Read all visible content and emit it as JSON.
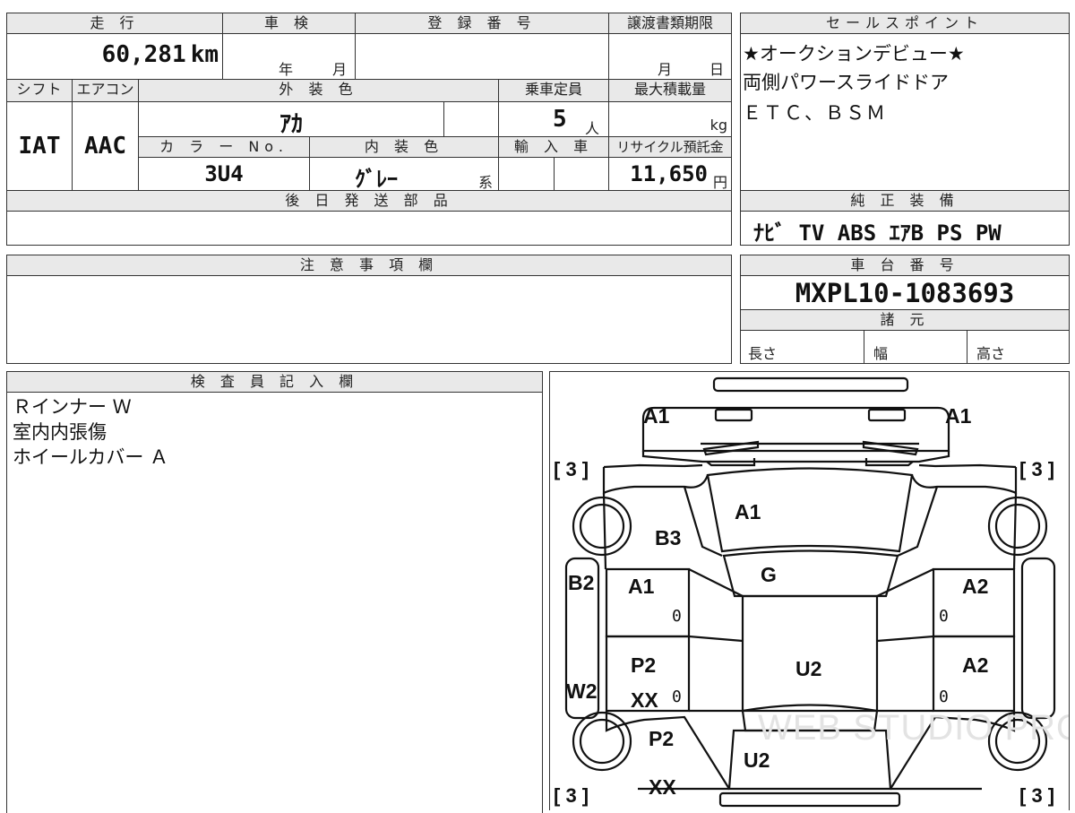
{
  "vehicle": {
    "mileage_label": "走 行",
    "mileage_value": "60,281",
    "mileage_unit": "km",
    "inspection_label": "車 検",
    "year_label": "年",
    "month_label": "月",
    "registration_label": "登 録 番 号",
    "transfer_label": "譲渡書類期限",
    "transfer_month": "月",
    "transfer_day": "日",
    "shift_label": "シフト",
    "shift_value": "IAT",
    "aircon_label": "エアコン",
    "aircon_value": "AAC",
    "exterior_label": "外 装 色",
    "exterior_value": "ｱｶ",
    "capacity_label": "乗車定員",
    "capacity_value": "5",
    "capacity_unit": "人",
    "maxload_label": "最大積載量",
    "maxload_unit": "kg",
    "color_no_label": "カ ラ ー No.",
    "color_no_value": "3U4",
    "interior_label": "内 装 色",
    "interior_value": "ｸﾞﾚｰ",
    "interior_unit": "系",
    "import_label": "輸 入 車",
    "recycle_label": "リサイクル預託金",
    "recycle_value": "11,650",
    "recycle_unit": "円",
    "later_parts_label": "後 日 発 送 部 品"
  },
  "sales": {
    "label": "セールスポイント",
    "lines": [
      "★オークションデビュー★",
      "両側パワースライドドア",
      "ＥＴＣ、ＢＳＭ"
    ]
  },
  "equipment": {
    "label": "純 正 装 備",
    "value": "ﾅﾋﾞ TV ABS ｴｱB PS PW"
  },
  "notes": {
    "label": "注 意 事 項 欄"
  },
  "chassis": {
    "label": "車 台 番 号",
    "value": "MXPL10-1083693",
    "spec_label": "諸 元",
    "length_label": "長さ",
    "width_label": "幅",
    "height_label": "高さ"
  },
  "inspector": {
    "label": "検 査 員 記 入 欄",
    "lines": [
      "Ｒインナー Ｗ",
      "室内内張傷",
      "ホイールカバー Ａ"
    ]
  },
  "diagram": {
    "marks": {
      "front_left": "A1",
      "front_right": "A1",
      "hood": "A1",
      "fender_left": "B3",
      "windshield": "G",
      "rocker_left": "B2",
      "rocker_left2": "W2",
      "front_door_left": "A1",
      "front_door_right": "A2",
      "rear_door_left_1": "P2",
      "rear_door_left_2": "XX",
      "rear_door_right": "A2",
      "roof": "U2",
      "rear_quarter_left_1": "P2",
      "rear_quarter_left_2": "XX",
      "rear_roof": "U2",
      "tire_fl": "[ 3 ]",
      "tire_fr": "[ 3 ]",
      "tire_rl": "[ 3 ]",
      "tire_rr": "[ 3 ]",
      "zero": "0"
    },
    "watermark": "WEB STUDIO PRO"
  }
}
